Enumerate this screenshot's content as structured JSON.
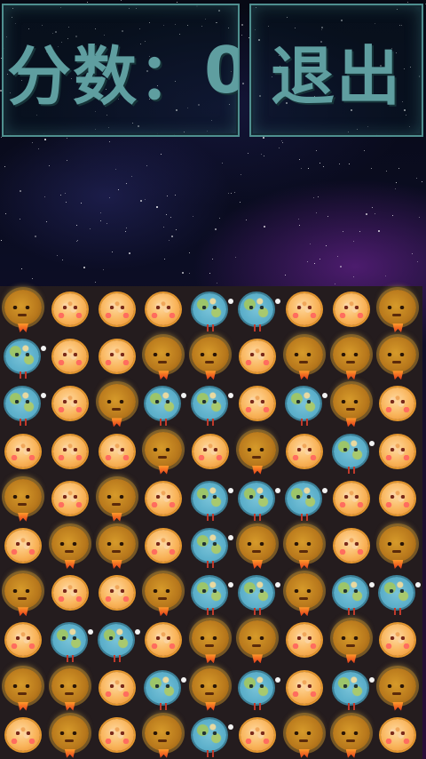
{
  "header": {
    "score_label": "分数：",
    "score_value": "0",
    "exit_label": "退出"
  },
  "colors": {
    "panel_text": "#5f9ea0",
    "panel_border": "#4f8f8f",
    "board_bg": "#241c1e"
  },
  "piece_types": {
    "S": "sun-planet-icon",
    "E": "earth-planet-icon",
    "D": "dark-planet-icon"
  },
  "board": {
    "rows": 10,
    "cols": 9,
    "grid": [
      [
        "D",
        "S",
        "S",
        "S",
        "E",
        "E",
        "S",
        "S",
        "D"
      ],
      [
        "E",
        "S",
        "S",
        "D",
        "D",
        "S",
        "D",
        "D",
        "D"
      ],
      [
        "E",
        "S",
        "D",
        "E",
        "E",
        "S",
        "E",
        "D",
        "S"
      ],
      [
        "S",
        "S",
        "S",
        "D",
        "S",
        "D",
        "S",
        "E",
        "S"
      ],
      [
        "D",
        "S",
        "D",
        "S",
        "E",
        "E",
        "E",
        "S",
        "S"
      ],
      [
        "S",
        "D",
        "D",
        "S",
        "E",
        "D",
        "D",
        "S",
        "D"
      ],
      [
        "D",
        "S",
        "S",
        "D",
        "E",
        "E",
        "D",
        "E",
        "E"
      ],
      [
        "S",
        "E",
        "E",
        "S",
        "D",
        "D",
        "S",
        "D",
        "S"
      ],
      [
        "D",
        "D",
        "S",
        "E",
        "D",
        "E",
        "S",
        "E",
        "D"
      ],
      [
        "S",
        "D",
        "S",
        "D",
        "E",
        "S",
        "D",
        "D",
        "S"
      ]
    ]
  }
}
